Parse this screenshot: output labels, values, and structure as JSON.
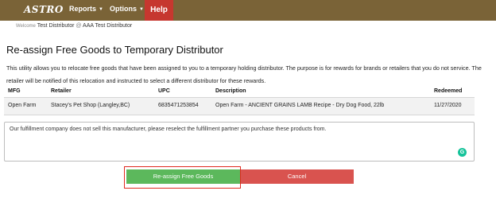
{
  "navbar": {
    "logo": "ASTRO",
    "reports_label": "Reports",
    "options_label": "Options",
    "help_label": "Help"
  },
  "welcome": {
    "prefix": "Welcome",
    "user": "Test Distributor",
    "at": "@",
    "distributor": "AAA Test Distributor"
  },
  "page": {
    "title": "Re-assign Free Goods to Temporary Distributor",
    "description": "This utility allows you to relocate free goods that have been assigned to you to a temporary holding distributor. The purpose is for rewards for brands or retailers that you do not service. The retailer will be notified of this relocation and instructed to select a different distributor for these rewards."
  },
  "table": {
    "headers": {
      "mfg": "MFG",
      "retailer": "Retailer",
      "upc": "UPC",
      "description": "Description",
      "redeemed": "Redeemed"
    },
    "rows": [
      {
        "mfg": "Open Farm",
        "retailer": "Stacey's Pet Shop (Langley,BC)",
        "upc": "6835471253854",
        "description": "Open Farm - ANCIENT GRAINS LAMB Recipe - Dry Dog Food, 22lb",
        "redeemed": "11/27/2020"
      }
    ]
  },
  "message": {
    "value": "Our fulfillment company does not sell this manufacturer, please reselect the fulfillment partner you purchase these products from."
  },
  "actions": {
    "reassign_label": "Re-assign Free Goods",
    "cancel_label": "Cancel"
  },
  "colors": {
    "navbar": "#7a6337",
    "help": "#c6372f",
    "reassign": "#5cb85c",
    "cancel": "#d9534f",
    "highlight": "#e0291f"
  }
}
